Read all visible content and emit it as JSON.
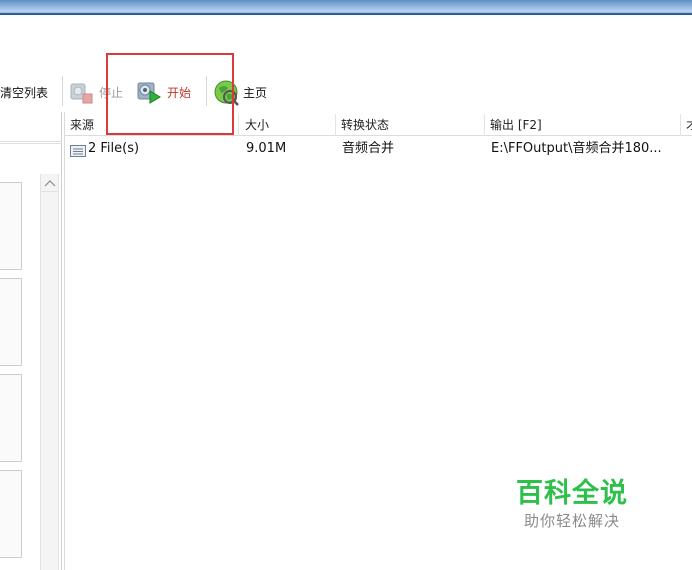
{
  "toolbar": {
    "clear_list_label": "清空列表",
    "stop_label": "停止",
    "start_label": "开始",
    "home_label": "主页"
  },
  "list": {
    "columns": [
      "来源",
      "大小",
      "转换状态",
      "输出 [F2]",
      "才"
    ],
    "rows": [
      {
        "source": "2 File(s)",
        "size": "9.01M",
        "status": "音频合并",
        "output": "E:\\FFOutput\\音频合并180..."
      }
    ]
  },
  "watermark": {
    "title": "百科全说",
    "subtitle": "助你轻松解决"
  },
  "colors": {
    "highlight": "#d93a3a",
    "start_text": "#c0392b",
    "watermark_green": "#2ec04b"
  },
  "icons": [
    "clear-list-icon",
    "stop-icon",
    "start-icon",
    "home-globe-icon",
    "file-list-icon",
    "scroll-up-arrow-icon"
  ]
}
